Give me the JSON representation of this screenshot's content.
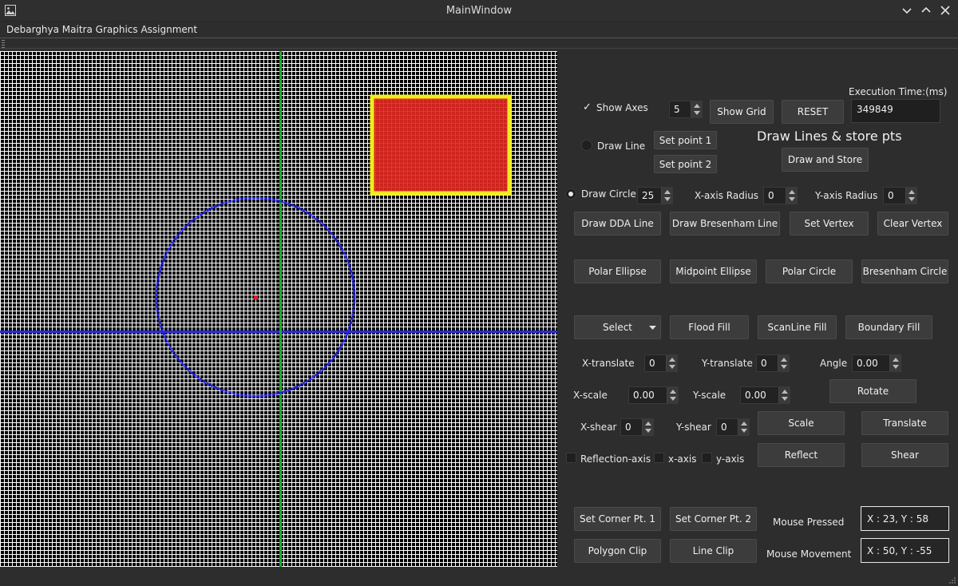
{
  "window": {
    "title": "MainWindow"
  },
  "menu": {
    "label": "Debarghya Maitra Graphics Assignment"
  },
  "execution": {
    "label": "Execution Time:(ms)",
    "value": "349849"
  },
  "controls": {
    "show_axes": {
      "label": "Show Axes",
      "checked": true
    },
    "grid_size": "5",
    "show_grid": "Show Grid",
    "reset": "RESET",
    "draw_lines_title": "Draw Lines & store pts",
    "draw_line": {
      "label": "Draw Line",
      "selected": false
    },
    "set_point1": "Set point 1",
    "set_point2": "Set point 2",
    "draw_and_store": "Draw and Store",
    "draw_circle": {
      "label": "Draw Circle",
      "selected": true
    },
    "circle_radius": "25",
    "x_axis_radius_label": "X-axis Radius",
    "x_axis_radius": "0",
    "y_axis_radius_label": "Y-axis Radius",
    "y_axis_radius": "0",
    "draw_dda_line": "Draw DDA Line",
    "draw_bresenham_line": "Draw Bresenham Line",
    "set_vertex": "Set Vertex",
    "clear_vertex": "Clear Vertex",
    "polar_ellipse": "Polar Ellipse",
    "midpoint_ellipse": "Midpoint Ellipse",
    "polar_circle": "Polar Circle",
    "bresenham_circle": "Bresenham Circle",
    "select": "Select",
    "flood_fill": "Flood Fill",
    "scanline_fill": "ScanLine Fill",
    "boundary_fill": "Boundary Fill",
    "x_translate_label": "X-translate",
    "x_translate": "0",
    "y_translate_label": "Y-translate",
    "y_translate": "0",
    "angle_label": "Angle",
    "angle": "0.00",
    "x_scale_label": "X-scale",
    "x_scale": "0.00",
    "y_scale_label": "Y-scale",
    "y_scale": "0.00",
    "rotate": "Rotate",
    "x_shear_label": "X-shear",
    "x_shear": "0",
    "y_shear_label": "Y-shear",
    "y_shear": "0",
    "scale": "Scale",
    "translate": "Translate",
    "reflection_axis_label": "Reflection-axis",
    "x_axis_label": "x-axis",
    "y_axis_label": "y-axis",
    "reflect": "Reflect",
    "shear": "Shear",
    "set_corner1": "Set Corner Pt. 1",
    "set_corner2": "Set Corner Pt. 2",
    "mouse_pressed_label": "Mouse Pressed",
    "mouse_pressed_value": "X : 23, Y : 58",
    "polygon_clip": "Polygon Clip",
    "line_clip": "Line Clip",
    "mouse_movement_label": "Mouse Movement",
    "mouse_movement_value": "X : 50, Y : -55"
  },
  "colors": {
    "axis_x": "#2b2bd6",
    "axis_y": "#1faa2f",
    "circle": "#2424e0",
    "rect_fill": "#e1271f",
    "rect_border": "#f2ec1c",
    "center_point": "#e02020"
  }
}
